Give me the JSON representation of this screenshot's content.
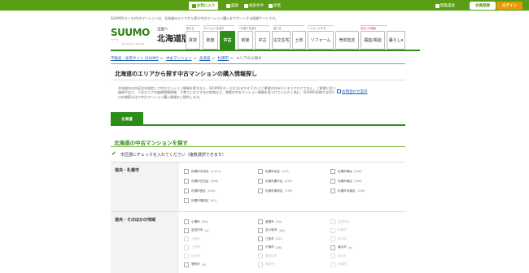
{
  "topbar": {
    "favorites": "お気に入り",
    "history": "履歴",
    "conditions": "検索条件",
    "mail": "新着",
    "browse": "閲覧履歴",
    "member": "会員登録",
    "login": "ログイン"
  },
  "header": {
    "tagline": "SUUMO(スーモ)中古マンションは、北海道のエリアから探す中古マンション購入をサポートする情報サイトです。",
    "logo": "SUUMO",
    "logo_sub": "スーモ",
    "logo_tiny": "Powered by Recruit",
    "region_small": "全国へ",
    "region": "北海道版",
    "categories": [
      "探せる",
      "マンションを探す",
      "一戸建てを探す",
      "建てる",
      "リフォームする",
      "住まいの相談"
    ],
    "nav": [
      "賃貸",
      "新築",
      "中古",
      "新築",
      "中古",
      "注文住宅",
      "土地",
      "リフォーム",
      "売却査定",
      "講座/相談",
      "暮らし"
    ]
  },
  "breadcrumbs": [
    "不動産・住宅サイト SUUMO",
    "中古マンション",
    "北海道",
    "札幌市",
    "エリアから探す"
  ],
  "page": {
    "title": "北海道のエリアから探す中古マンションの購入情報探し",
    "intro": "北海道内の市区町を指定して中古マンション情報を探すなら、SUUMO(スーモ)におまかせ下さい!ご希望の住みたいエリアだけでなく、ご希望に合う価格や広さ、人気エリアの価格相場情報、子育てにおすすめの地域など、理想の中古マンション情報を見つけていただく為に、SUUMOは様々な切り口の検索方法で中古マンション購入情報をご提供します。",
    "side_link": "お問合わせ案内",
    "tab": "北海道",
    "section_title": "北海道の中古マンションを探す",
    "instruction": "市区郡にチェックを入れてください（複数選択できます）"
  },
  "groups": [
    {
      "title": "道央・札幌市",
      "cities": [
        {
          "name": "札幌市中央区",
          "count": "(1,211)",
          "enabled": true
        },
        {
          "name": "札幌市北区",
          "count": "(257)",
          "enabled": true
        },
        {
          "name": "札幌市東区",
          "count": "(240)",
          "enabled": true
        },
        {
          "name": "札幌市白石区",
          "count": "(426)",
          "enabled": true
        },
        {
          "name": "札幌市豊平区",
          "count": "(375)",
          "enabled": true
        },
        {
          "name": "札幌市南区",
          "count": "(169)",
          "enabled": true
        },
        {
          "name": "札幌市西区",
          "count": "(416)",
          "enabled": true
        },
        {
          "name": "札幌市厚別区",
          "count": "(178)",
          "enabled": true
        },
        {
          "name": "札幌市手稲区",
          "count": "(116)",
          "enabled": true
        },
        {
          "name": "札幌市清田区",
          "count": "(91)",
          "enabled": true
        }
      ]
    },
    {
      "title": "道央・そのほかの地域",
      "cities": [
        {
          "name": "小樽市",
          "count": "(54)",
          "enabled": true
        },
        {
          "name": "室蘭市",
          "count": "(24)",
          "enabled": true
        },
        {
          "name": "岩見沢市",
          "count": "",
          "enabled": false
        },
        {
          "name": "岩見沢市",
          "count": "(4)",
          "enabled": true
        },
        {
          "name": "苫小牧市",
          "count": "(26)",
          "enabled": true
        },
        {
          "name": "芦別市",
          "count": "",
          "enabled": false
        },
        {
          "name": "夕張市",
          "count": "",
          "enabled": false
        },
        {
          "name": "江別市",
          "count": "(22)",
          "enabled": true
        },
        {
          "name": "赤平市",
          "count": "",
          "enabled": false
        },
        {
          "name": "三笠市",
          "count": "",
          "enabled": false
        },
        {
          "name": "千歳市",
          "count": "(28)",
          "enabled": true
        },
        {
          "name": "滝川市",
          "count": "(4)",
          "enabled": true
        },
        {
          "name": "砂川市",
          "count": "",
          "enabled": false
        },
        {
          "name": "歌志内市",
          "count": "",
          "enabled": false
        },
        {
          "name": "深川市",
          "count": "",
          "enabled": false
        },
        {
          "name": "登別市",
          "count": "(4)",
          "enabled": true
        },
        {
          "name": "恵庭市",
          "count": "",
          "enabled": false
        },
        {
          "name": "伊達市",
          "count": "",
          "enabled": false
        }
      ]
    }
  ]
}
